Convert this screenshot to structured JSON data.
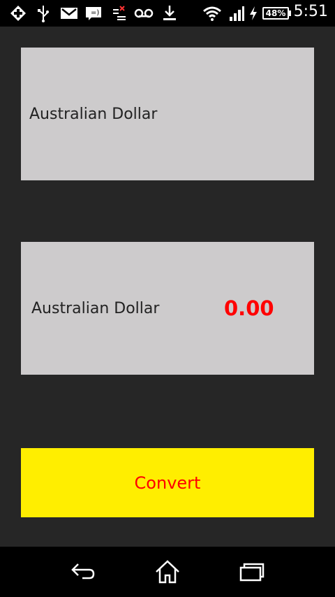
{
  "statusbar": {
    "time": "5:51",
    "battery_percent": "48%",
    "icons": [
      "plus-icon",
      "usb-icon",
      "gmail-icon",
      "message-icon",
      "sim-icon",
      "voicemail-icon",
      "download-icon",
      "wifi-icon",
      "signal-icon",
      "charging-icon",
      "battery-icon"
    ]
  },
  "converter": {
    "from_currency": "Australian Dollar",
    "to_currency": "Australian Dollar",
    "result": "0.00",
    "convert_label": "Convert"
  },
  "colors": {
    "background": "#262626",
    "panel": "#cdcbcc",
    "button": "#ffee00",
    "accent_text": "#ff0000"
  },
  "navbar": {
    "icons": [
      "back-icon",
      "home-icon",
      "recents-icon"
    ]
  }
}
